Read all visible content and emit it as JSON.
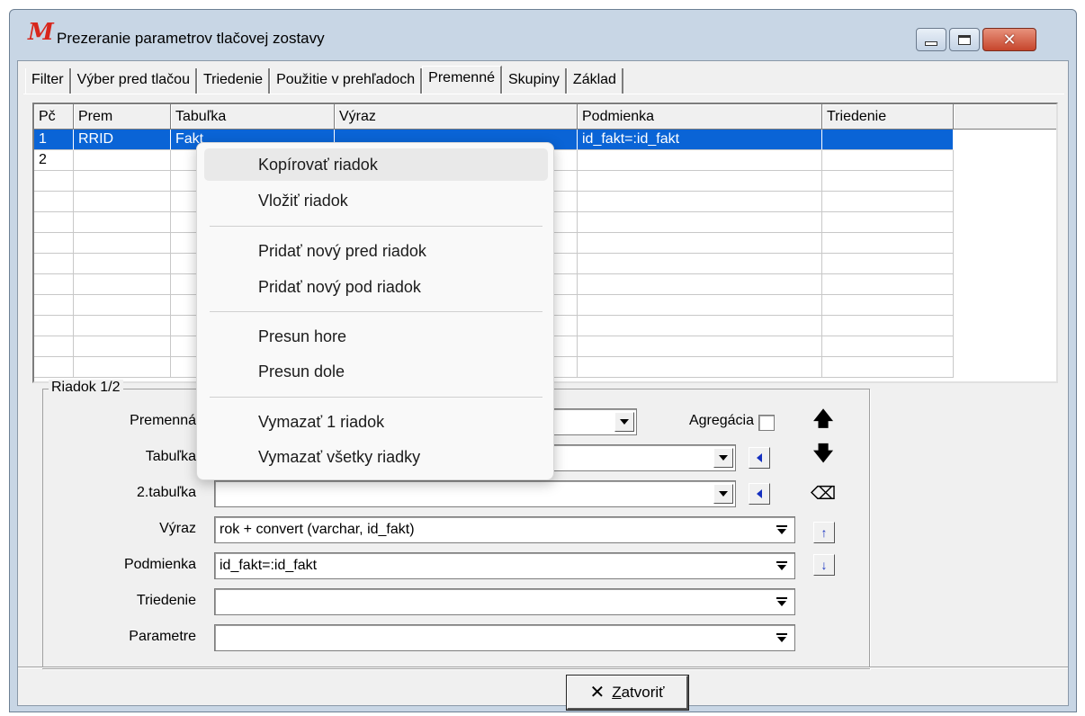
{
  "window": {
    "logo": "M",
    "title": "Prezeranie parametrov tlačovej zostavy"
  },
  "tabs": [
    {
      "label": "Filter"
    },
    {
      "label": "Výber pred tlačou"
    },
    {
      "label": "Triedenie"
    },
    {
      "label": "Použitie v prehľadoch"
    },
    {
      "label": "Premenné",
      "active": true
    },
    {
      "label": "Skupiny"
    },
    {
      "label": "Základ"
    }
  ],
  "grid": {
    "columns": [
      "Pč",
      "Prem",
      "Tabuľka",
      "Výraz",
      "Podmienka",
      "Triedenie"
    ],
    "rows": [
      {
        "pc": "1",
        "prem": "RRID",
        "tabulka": "Fakt",
        "vyraz": "",
        "podmienka": "id_fakt=:id_fakt",
        "triedenie": "",
        "selected": true
      },
      {
        "pc": "2",
        "prem": "",
        "tabulka": "",
        "vyraz": "",
        "podmienka": "",
        "triedenie": "",
        "selected": false
      }
    ]
  },
  "detail": {
    "group_title": "Riadok 1/2",
    "labels": {
      "premenna": "Premenná",
      "tabulka": "Tabuľka",
      "tabulka2": "2.tabuľka",
      "vyraz": "Výraz",
      "podmienka": "Podmienka",
      "triedenie": "Triedenie",
      "parametre": "Parametre",
      "agregacia": "Agregácia"
    },
    "values": {
      "premenna": "",
      "tabulka": "",
      "tabulka2": "",
      "vyraz": "rok + convert (varchar, id_fakt)",
      "podmienka": "id_fakt=:id_fakt",
      "triedenie": "",
      "parametre": ""
    },
    "agregacia_checked": false
  },
  "footer": {
    "close_label": "Zatvoriť",
    "close_icon": "✕"
  },
  "context_menu": {
    "items": [
      {
        "label": "Kopírovať riadok"
      },
      {
        "label": "Vložiť riadok"
      },
      {
        "label": "Pridať nový pred riadok"
      },
      {
        "label": "Pridať nový pod riadok"
      },
      {
        "label": "Presun hore"
      },
      {
        "label": "Presun dole"
      },
      {
        "label": "Vymazať 1 riadok"
      },
      {
        "label": "Vymazať všetky riadky"
      }
    ]
  },
  "colors": {
    "selection": "#0a64d6",
    "logo": "#d8261c",
    "close_button": "#c6452c"
  }
}
